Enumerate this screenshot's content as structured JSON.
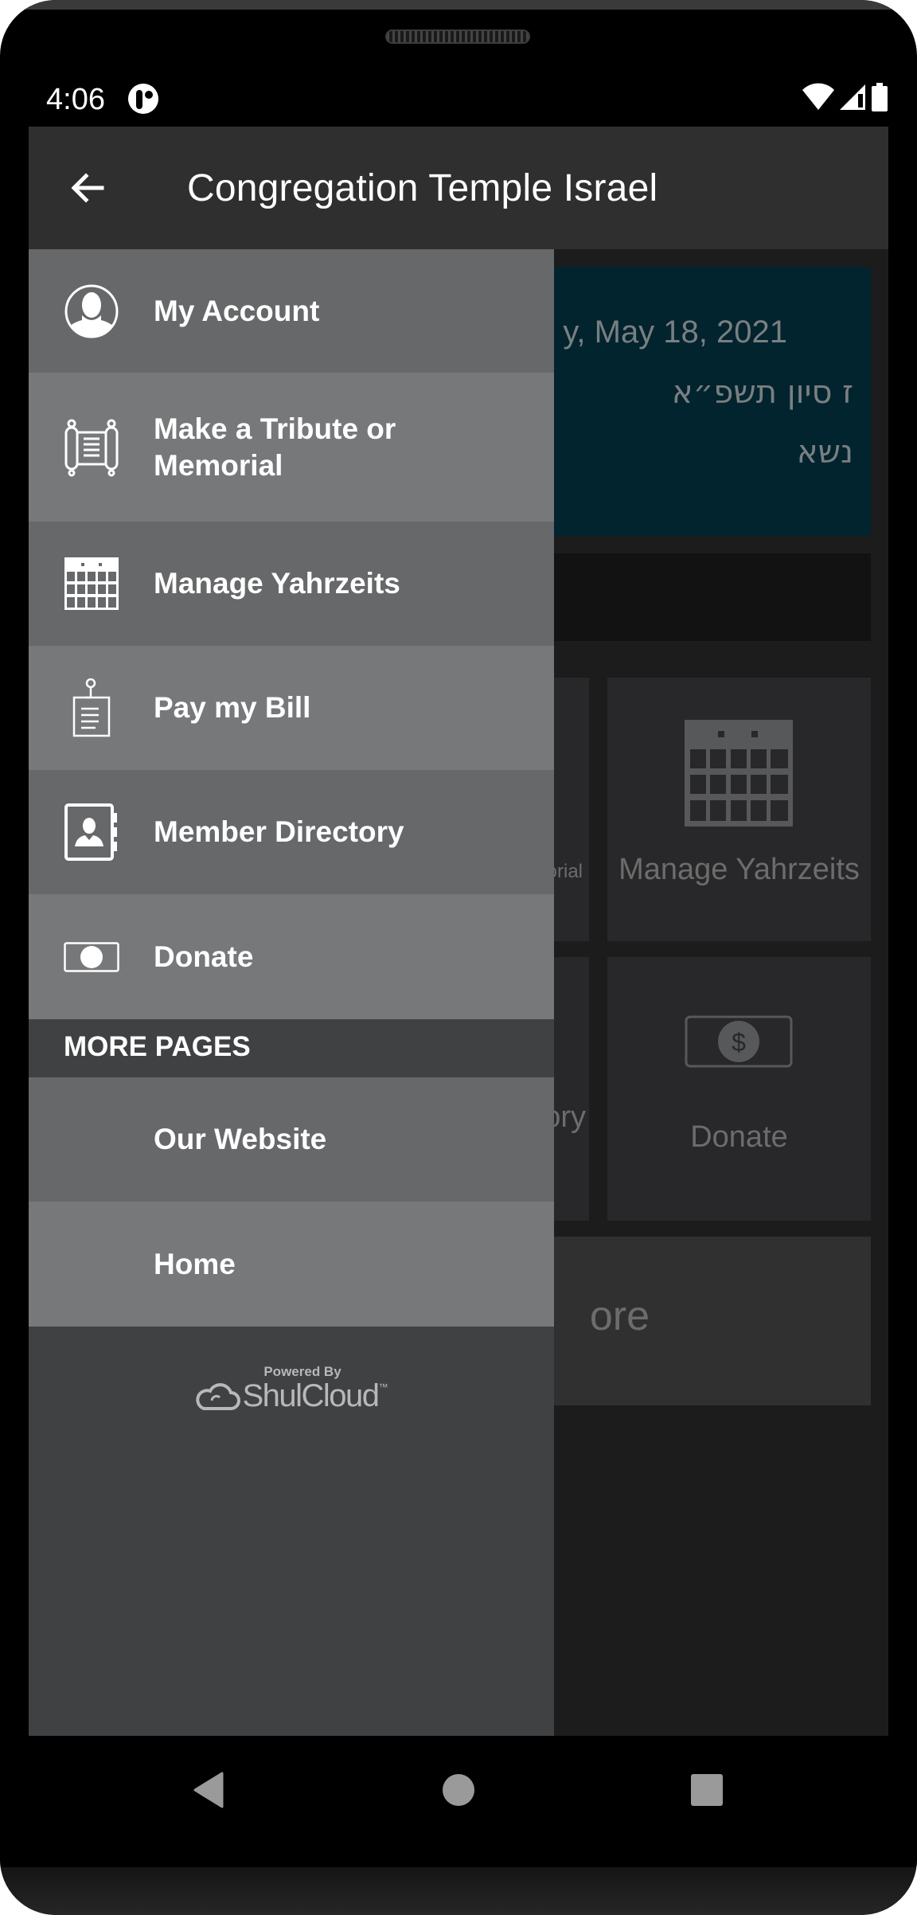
{
  "status_bar": {
    "time": "4:06",
    "notification_icon": "app-notification-icon",
    "icons": [
      "wifi-icon",
      "signal-icon",
      "battery-icon"
    ]
  },
  "topbar": {
    "back_icon": "arrow-left-icon",
    "title": "Congregation Temple Israel"
  },
  "background": {
    "date_gregorian_partial": "y, May 18, 2021",
    "date_hebrew": "ז סיון תשפ״א",
    "parsha": "נשא",
    "tiles": [
      {
        "label_partial": "orial",
        "icon": null
      },
      {
        "label": "Manage Yahrzeits",
        "icon": "calendar-icon"
      },
      {
        "label_partial": "ory",
        "icon": null
      },
      {
        "label": "Donate",
        "icon": "dollar-bill-icon"
      }
    ],
    "wide_tile_partial": "ore"
  },
  "drawer": {
    "items": [
      {
        "label": "My Account",
        "icon": "user-circle-icon"
      },
      {
        "label": "Make a Tribute or Memorial",
        "icon": "torah-scroll-icon"
      },
      {
        "label": "Manage Yahrzeits",
        "icon": "calendar-icon"
      },
      {
        "label": "Pay my Bill",
        "icon": "bill-icon"
      },
      {
        "label": "Member Directory",
        "icon": "address-book-icon"
      },
      {
        "label": "Donate",
        "icon": "cash-icon"
      }
    ],
    "section_header": "MORE PAGES",
    "more_pages": [
      {
        "label": "Our Website"
      },
      {
        "label": "Home"
      }
    ],
    "footer": {
      "powered_by": "Powered By",
      "brand": "ShulCloud",
      "trademark": "™"
    }
  },
  "navbar": {
    "buttons": [
      "back-nav-icon",
      "home-nav-icon",
      "recents-nav-icon"
    ]
  },
  "colors": {
    "topbar": "#2f2f2f",
    "drawer_item_dark": "#67686a",
    "drawer_item_light": "#77787a",
    "drawer_bg": "#404143",
    "date_card": "#02242f"
  }
}
